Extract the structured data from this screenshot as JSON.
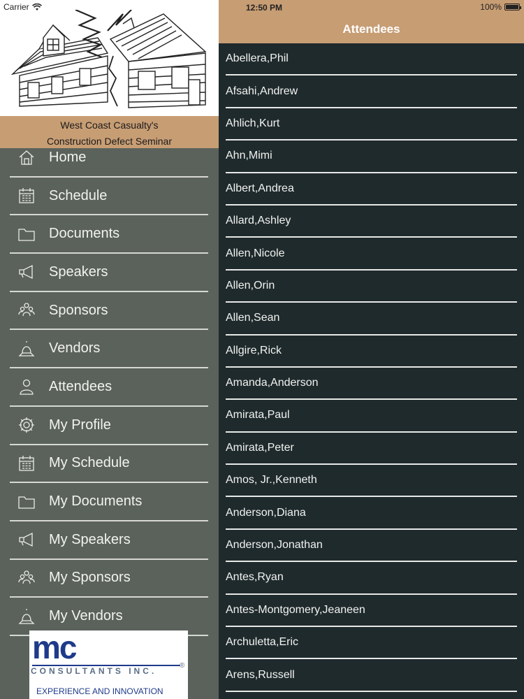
{
  "status_bar": {
    "carrier": "Carrier",
    "time": "12:50 PM",
    "battery": "100%"
  },
  "sidebar": {
    "banner_line1": "West Coast Casualty's",
    "banner_line2": "Construction Defect Seminar",
    "menu": [
      {
        "label": "Home",
        "icon": "home-icon"
      },
      {
        "label": "Schedule",
        "icon": "calendar-icon"
      },
      {
        "label": "Documents",
        "icon": "folder-icon"
      },
      {
        "label": "Speakers",
        "icon": "megaphone-icon"
      },
      {
        "label": "Sponsors",
        "icon": "group-icon"
      },
      {
        "label": "Vendors",
        "icon": "bell-icon"
      },
      {
        "label": "Attendees",
        "icon": "person-icon"
      },
      {
        "label": "My Profile",
        "icon": "gear-icon"
      },
      {
        "label": "My Schedule",
        "icon": "calendar-icon"
      },
      {
        "label": "My Documents",
        "icon": "folder-icon"
      },
      {
        "label": "My Speakers",
        "icon": "megaphone-icon"
      },
      {
        "label": "My Sponsors",
        "icon": "group-icon"
      },
      {
        "label": "My Vendors",
        "icon": "bell-icon"
      }
    ],
    "sponsor": {
      "mark": "mc",
      "name": "CONSULTANTS INC.",
      "reg": "®",
      "tagline": "EXPERIENCE AND INNOVATION"
    }
  },
  "panel": {
    "title": "Attendees",
    "attendees": [
      "Abellera,Phil",
      "Afsahi,Andrew",
      "Ahlich,Kurt",
      "Ahn,Mimi",
      "Albert,Andrea",
      "Allard,Ashley",
      "Allen,Nicole",
      "Allen,Orin",
      "Allen,Sean",
      "Allgire,Rick",
      "Amanda,Anderson",
      "Amirata,Paul",
      "Amirata,Peter",
      "Amos, Jr.,Kenneth",
      "Anderson,Diana",
      "Anderson,Jonathan",
      "Antes,Ryan",
      "Antes-Montgomery,Jeaneen",
      "Archuletta,Eric",
      "Arens,Russell"
    ]
  },
  "colors": {
    "accent": "#c79d74",
    "sidebar_bg": "#5b625c",
    "panel_bg": "#1f2a2d",
    "divider": "#e7e9e6"
  }
}
